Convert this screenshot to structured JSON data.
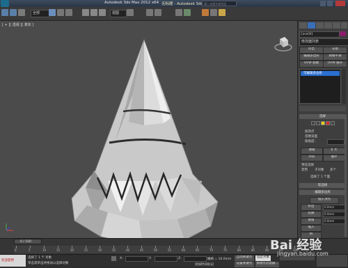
{
  "titlebar": {
    "title": "Autodesk 3ds Max  2012 x64",
    "filename": "无标题 - Autodesk 3ds Max",
    "search_placeholder": "键入关键字或短语"
  },
  "toolbar": {
    "selection_filter": "全部",
    "view_dropdown": "视图"
  },
  "viewport": {
    "label": "[ + ][ 透视 ][ 真实 ]"
  },
  "panel": {
    "object_name": "Cone001",
    "modifier_list": "修改器列表",
    "buttons": [
      "挤出",
      "车削",
      "编辑多边形",
      "网格平滑",
      "UVW 贴图",
      "UVW 展开"
    ],
    "stack_item": "可编辑多边形",
    "selection_rollout": "选择",
    "selection_checks": [
      "按顶点",
      "忽略背面",
      "按角度:",
      "收缩",
      "扩大",
      "环形",
      "循环"
    ],
    "preview_label": "预览选择",
    "preview_options": [
      "禁用",
      "子对象",
      "多个"
    ],
    "selected_info": "选择了 1 个面",
    "soft_selection": "软选择",
    "edit_polygons": "编辑多边形",
    "insert_vertex": "插入顶点",
    "edit_buttons": [
      "挤出",
      "轮廓",
      "倒角",
      "插入",
      "桥",
      "翻转",
      "从边旋转",
      "沿样条线挤出",
      "编辑三角剖分",
      "重复三角算法",
      "旋转"
    ],
    "spinner_values": [
      "0.0mm",
      "0.0mm",
      "0.0mm"
    ]
  },
  "timeline": {
    "frame_counter": "0 / 100",
    "ticks": [
      "0",
      "5",
      "10",
      "15",
      "20",
      "25",
      "30",
      "35",
      "40",
      "45",
      "50",
      "55",
      "60",
      "65",
      "70",
      "75",
      "80",
      "85",
      "90",
      "95",
      "100"
    ]
  },
  "status": {
    "mini_listener": "欢迎使用",
    "selected": "选择了 1 个 对象",
    "prompt": "单击或单击并拖动以选择对象",
    "x_label": "X:",
    "y_label": "Y:",
    "z_label": "Z:",
    "grid": "栅格 = 10.0mm",
    "autokey": "自动关键点",
    "selected_obj": "选定对象",
    "set_key": "设置关键点",
    "key_filter": "关键点过滤器...",
    "add_time_tag": "添加时间标记"
  },
  "watermark": {
    "logo": "Bai 经验",
    "url": "jingyan.baidu.com"
  },
  "colors": {
    "accent_blue": "#2a6fcf",
    "highlight_yellow": "#e8d21a",
    "highlight_red": "#d42a2a"
  }
}
